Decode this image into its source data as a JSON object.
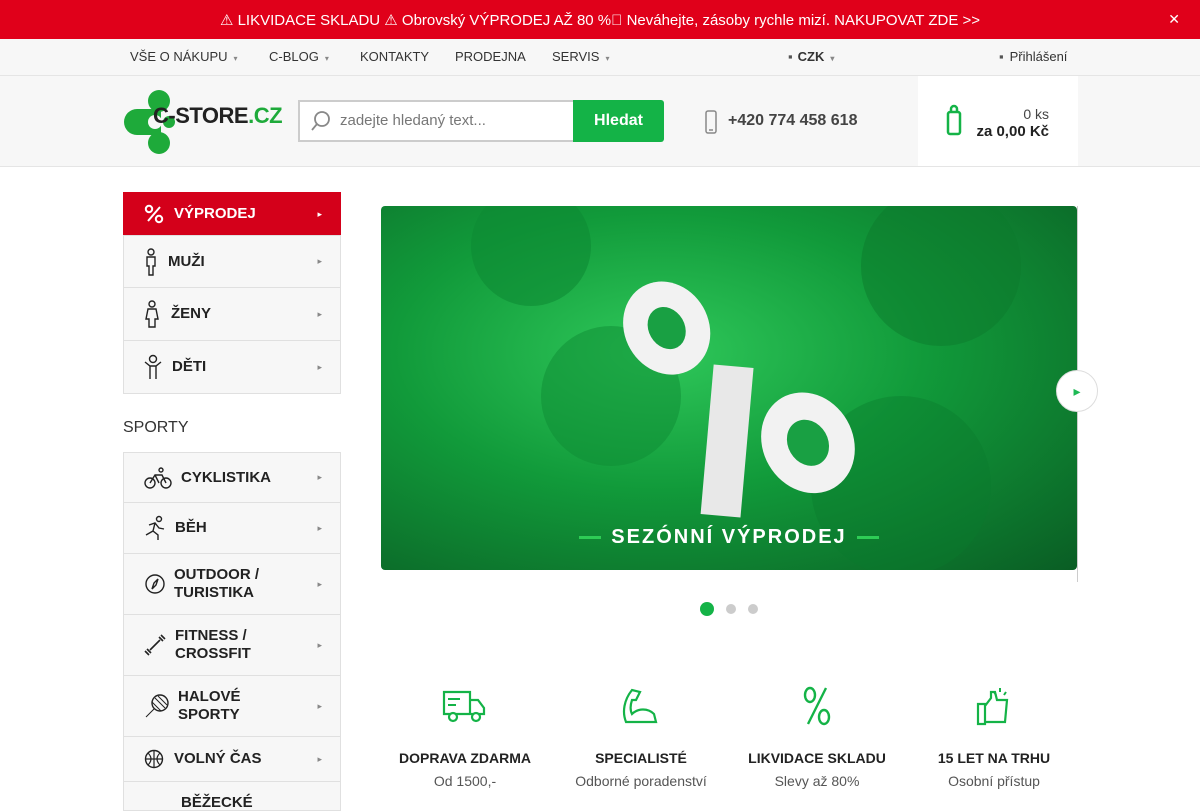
{
  "announcement": {
    "text": "⚠ LIKVIDACE SKLADU ⚠ Obrovský VÝPRODEJ AŽ 80 %⃣ Neváhejte, zásoby rychle mizí. NAKUPOVAT ZDE >>",
    "close_icon": "close-icon"
  },
  "nav": {
    "items": [
      {
        "label": "VŠE O NÁKUPU"
      },
      {
        "label": "C-BLOG"
      },
      {
        "label": "KONTAKTY"
      },
      {
        "label": "PRODEJNA"
      },
      {
        "label": "SERVIS"
      }
    ],
    "currency": "CZK",
    "login": "Přihlášení"
  },
  "header": {
    "logo_main": "C-STORE",
    "logo_tld": ".CZ",
    "search_placeholder": "zadejte hledaný text...",
    "search_button": "Hledat",
    "phone": "+420 774 458 618",
    "cart_count": "0 ks",
    "cart_total": "za 0,00 Kč"
  },
  "sidebar": {
    "main": [
      {
        "label": "VÝPRODEJ",
        "icon": "percent-icon"
      },
      {
        "label": "MUŽI",
        "icon": "man-icon"
      },
      {
        "label": "ŽENY",
        "icon": "woman-icon"
      },
      {
        "label": "DĚTI",
        "icon": "child-icon"
      }
    ],
    "sports_heading": "SPORTY",
    "sports": [
      {
        "label": "CYKLISTIKA",
        "icon": "bicycle-icon"
      },
      {
        "label": "BĚH",
        "icon": "runner-icon"
      },
      {
        "label": "OUTDOOR / TURISTIKA",
        "icon": "compass-icon"
      },
      {
        "label": "FITNESS / CROSSFIT",
        "icon": "dumbbell-icon"
      },
      {
        "label": "HALOVÉ SPORTY",
        "icon": "racket-icon"
      },
      {
        "label": "VOLNÝ ČAS",
        "icon": "ball-icon"
      },
      {
        "label": "BĚŽECKÉ",
        "icon": "ski-icon"
      }
    ]
  },
  "banner": {
    "caption": "SEZÓNNÍ VÝPRODEJ",
    "active_slide": 1,
    "slide_count": 3
  },
  "features": [
    {
      "title": "DOPRAVA ZDARMA",
      "subtitle": "Od 1500,-",
      "icon": "truck-icon"
    },
    {
      "title": "SPECIALISTÉ",
      "subtitle": "Odborné poradenství",
      "icon": "biceps-icon"
    },
    {
      "title": "LIKVIDACE SKLADU",
      "subtitle": "Slevy až 80%",
      "icon": "percent-icon"
    },
    {
      "title": "15 LET NA TRHU",
      "subtitle": "Osobní přístup",
      "icon": "thumbs-up-icon"
    }
  ],
  "colors": {
    "accent_red": "#e0001a",
    "accent_green": "#14b347"
  }
}
